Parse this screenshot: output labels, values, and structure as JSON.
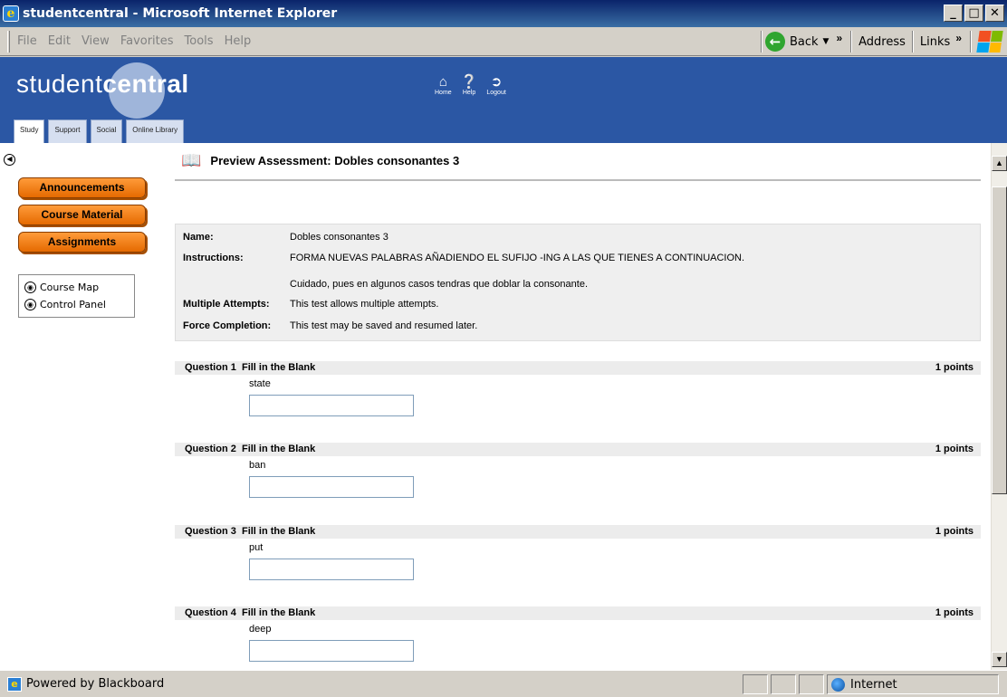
{
  "window": {
    "title": "studentcentral - Microsoft Internet Explorer"
  },
  "menu": [
    "File",
    "Edit",
    "View",
    "Favorites",
    "Tools",
    "Help"
  ],
  "toolbar": {
    "back_label": "Back",
    "address_label": "Address",
    "links_label": "Links"
  },
  "logo": {
    "part1": "student",
    "part2": "central"
  },
  "topnav": [
    {
      "label": "Home",
      "icon": "home-icon"
    },
    {
      "label": "Help",
      "icon": "help-icon"
    },
    {
      "label": "Logout",
      "icon": "logout-icon"
    }
  ],
  "tabs": [
    "Study",
    "Support",
    "Social",
    "Online Library"
  ],
  "sidebar": {
    "buttons": [
      "Announcements",
      "Course Material",
      "Assignments"
    ],
    "tools": [
      "Course Map",
      "Control Panel"
    ]
  },
  "page": {
    "title": "Preview Assessment: Dobles consonantes 3"
  },
  "info": {
    "name_label": "Name:",
    "name": "Dobles consonantes 3",
    "instructions_label": "Instructions:",
    "instructions1": "FORMA NUEVAS PALABRAS AÑADIENDO EL SUFIJO -ING A LAS QUE TIENES A CONTINUACION.",
    "instructions2": "Cuidado, pues en algunos casos tendras que doblar la consonante.",
    "attempts_label": "Multiple Attempts:",
    "attempts": "This test allows multiple attempts.",
    "force_label": "Force Completion:",
    "force": "This test may be saved and resumed later."
  },
  "questions": [
    {
      "label": "Question 1",
      "type": "Fill in the Blank",
      "points": "1 points",
      "word": "state"
    },
    {
      "label": "Question 2",
      "type": "Fill in the Blank",
      "points": "1 points",
      "word": "ban"
    },
    {
      "label": "Question 3",
      "type": "Fill in the Blank",
      "points": "1 points",
      "word": "put"
    },
    {
      "label": "Question 4",
      "type": "Fill in the Blank",
      "points": "1 points",
      "word": "deep"
    }
  ],
  "status": {
    "text": "Powered by Blackboard",
    "zone": "Internet"
  },
  "colors": {
    "header_blue": "#2b57a4",
    "button_orange": "#f07d1a"
  }
}
